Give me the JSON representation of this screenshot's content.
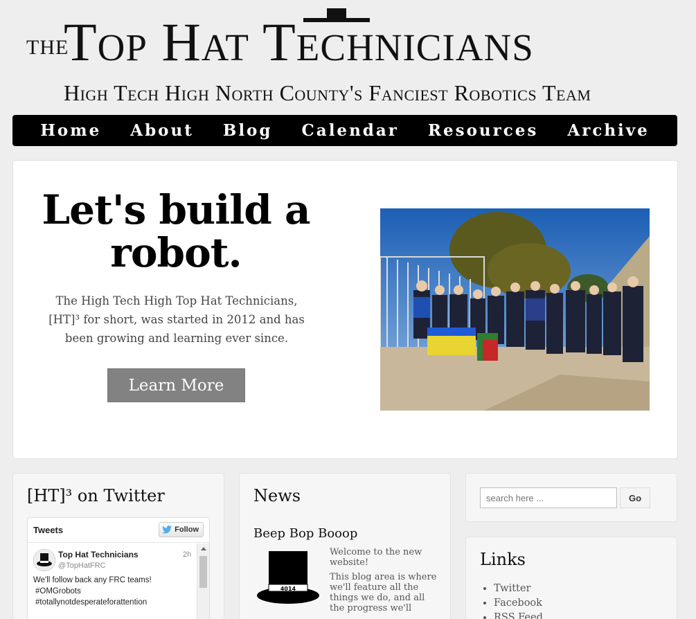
{
  "header": {
    "logo_the": "THE",
    "logo_title": "Top Hat Technicians",
    "tagline": "High Tech High North County's Fanciest Robotics Team"
  },
  "nav": {
    "items": [
      "Home",
      "About",
      "Blog",
      "Calendar",
      "Resources",
      "Archive"
    ]
  },
  "hero": {
    "title": "Let's build a robot.",
    "description": "The High Tech High Top Hat Technicians, [HT]³ for short, was started in 2012 and has been growing and learning ever since.",
    "button_label": "Learn More",
    "photo_alt": "team photo"
  },
  "twitter": {
    "panel_title": "[HT]³ on Twitter",
    "widget_label": "Tweets",
    "follow_label": "Follow",
    "tweet": {
      "name": "Top Hat Technicians",
      "handle": "@TopHatFRC",
      "time": "2h",
      "body_lines": [
        "We'll follow back any FRC teams!",
        "#OMGrobots",
        "#totallynotdesperateforattention"
      ]
    }
  },
  "news": {
    "panel_title": "News",
    "post_title": "Beep Bop Booop",
    "paragraph_1": "Welcome to the new website!",
    "paragraph_2": "This blog area is where we'll feature all the things we do, and all the progress we'll",
    "hat_badge": "4014"
  },
  "search": {
    "placeholder": "search here ...",
    "button_label": "Go"
  },
  "links": {
    "panel_title": "Links",
    "items": [
      "Twitter",
      "Facebook",
      "RSS Feed"
    ]
  },
  "colors": {
    "background": "#eeeeee",
    "nav_background": "#000000",
    "button_gray": "#828282",
    "twitter_blue": "#55acee"
  }
}
